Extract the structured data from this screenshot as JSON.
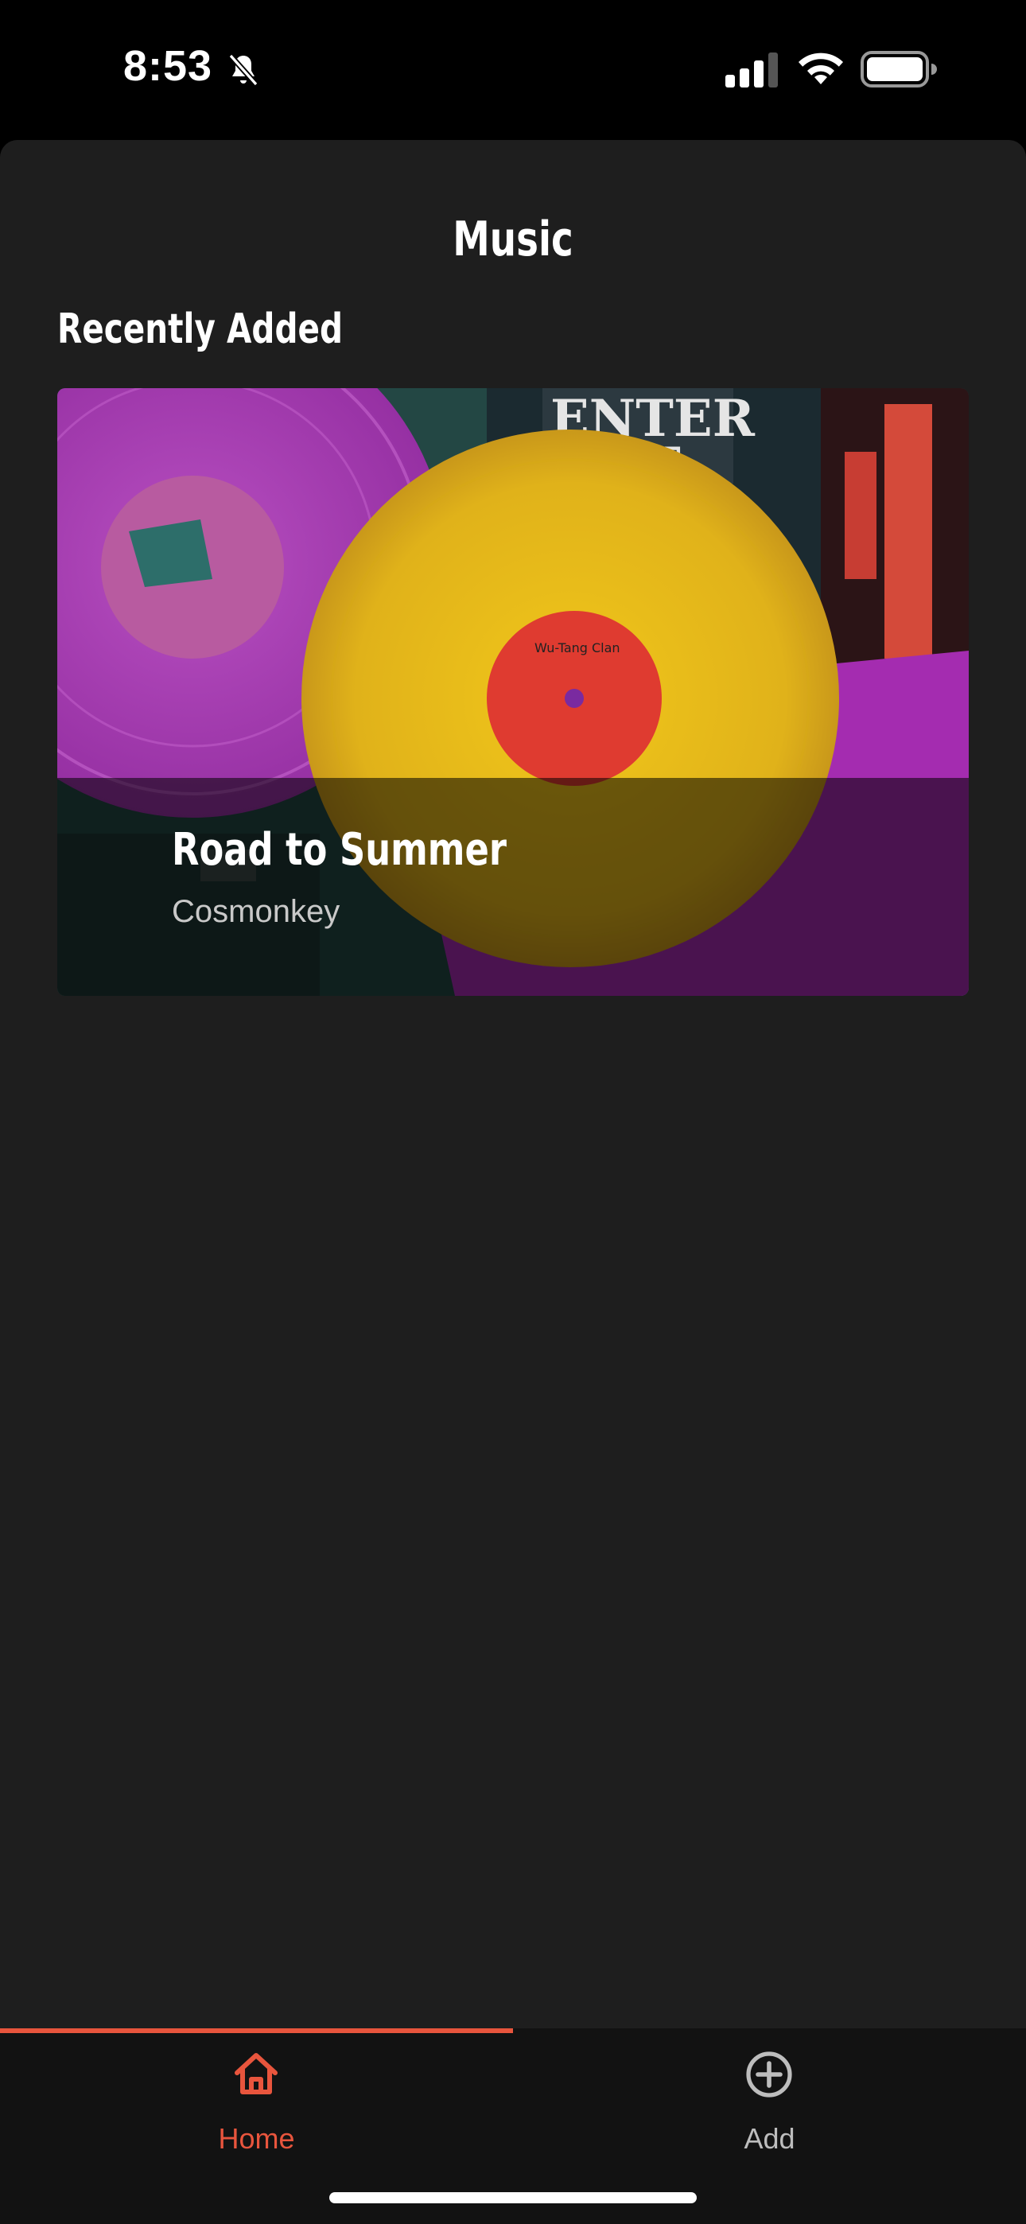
{
  "status_bar": {
    "time": "8:53",
    "icons": [
      "bell-slash-icon",
      "cellular-signal-icon",
      "wifi-icon",
      "battery-icon"
    ]
  },
  "header": {
    "title": "Music"
  },
  "recently_added": {
    "heading": "Recently Added",
    "items": [
      {
        "title": "Road to Summer",
        "artist": "Cosmonkey",
        "artwork_icon": "vinyl-records-artwork"
      }
    ]
  },
  "tab_bar": {
    "tabs": [
      {
        "label": "Home",
        "icon": "house-icon",
        "active": true
      },
      {
        "label": "Add",
        "icon": "plus-circle-icon",
        "active": false
      }
    ]
  },
  "colors": {
    "accent": "#e8553d",
    "background": "#1e1e1e",
    "tab_bar_background": "#121212",
    "inactive_tab": "#bdbdbd"
  }
}
